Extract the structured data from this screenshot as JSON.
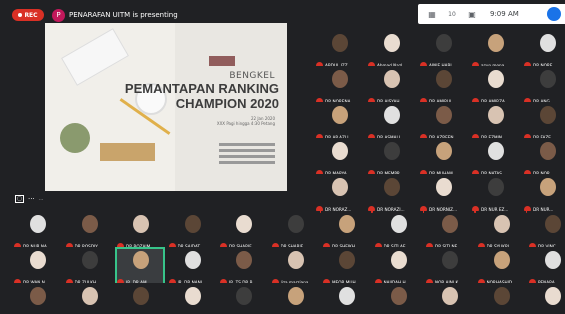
{
  "recording_label": "REC",
  "presenter": {
    "initial": "P",
    "text": "PENARAFAN UITM is presenting"
  },
  "system_bar": {
    "time": "9:09 AM",
    "counter": "10"
  },
  "slide": {
    "line1": "BENGKEL",
    "line2": "PEMANTAPAN RANKING",
    "line3": "CHAMPION 2020",
    "date": "22 Jan 2020",
    "venue": "XXX Pagi hingga 4:30 Petang",
    "caption": "..."
  },
  "colors": {
    "mic_muted": "#d93025",
    "active_speaker": "#37c48a",
    "background": "#202124"
  },
  "right_tiles": [
    [
      "ABDUL IZZ ...",
      "Ahmad Nazl...",
      "AINIE HABI...",
      "azun mona...",
      "DR NORE..."
    ],
    [
      "DR NORENA...",
      "DR AISYAH ...",
      "DR AMIRUL...",
      "DR AMIRZA...",
      "DR ANG..."
    ],
    [
      "DR AP AZLI...",
      "DR ASMALI...",
      "DR AZREEN...",
      "DR EZMIN ...",
      "DR FAZE..."
    ],
    [
      "DR MARYA...",
      "DR MEMPR...",
      "DR MUHAM...",
      "DR NATAS...",
      "DR NOR..."
    ],
    [
      "DR NORAZ...",
      "DR NORAZI...",
      "DR NORNIZ...",
      "DR NUR EZ...",
      "DR NUR..."
    ]
  ],
  "bottom_tiles": [
    [
      "DR NUR NA...",
      "DR ROSDIY...",
      "DR ROZAIM...",
      "DR SAIDAT...",
      "DR SHARIF...",
      "DR SHARIF...",
      "DR SHEIKH...",
      "DR SITI AE...",
      "DR SITI NE...",
      "DR SYUKRI...",
      "DR VINC..."
    ],
    [
      "DR WAN N...",
      "DR ZULKH...",
      "IR. DR AM...",
      "IR. DR NANI...",
      "IR. TS DR B...",
      "liza marziana",
      "MEOR MUH...",
      "NAJIDAH H...",
      "NOR AINI K...",
      "NORHASHID...",
      "PENARA..."
    ],
    [
      "PROF MADY...",
      "PROFESOR ...",
      "PROFESOR ...",
      "PROFESOR ...",
      "PROFESOR ...",
      "PROFESOR ...",
      "PROFESOR ...",
      "Seri Ayu Ma...",
      "SHARIFAH F...",
      "SUZEI MAT ...",
      "TS DR..."
    ]
  ],
  "active_tile": "IR. DR AM..."
}
